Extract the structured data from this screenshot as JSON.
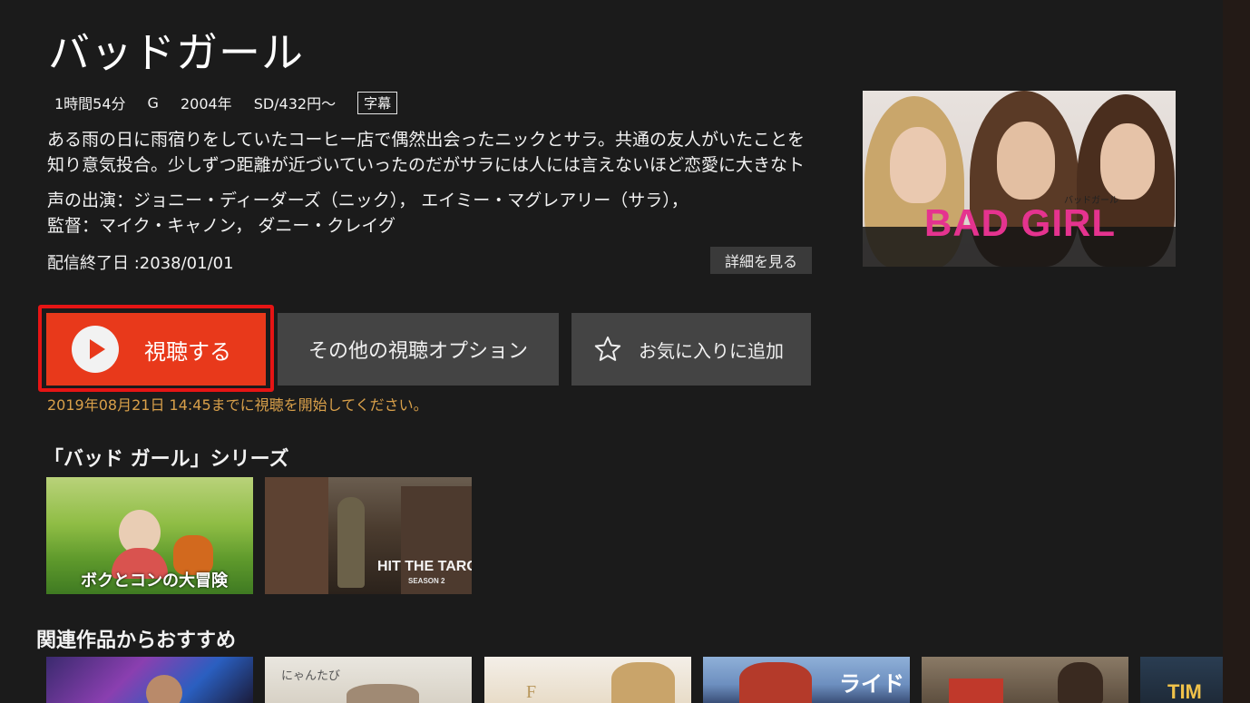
{
  "title": "バッドガール",
  "meta": {
    "duration": "1時間54分",
    "rating": "G",
    "year": "2004年",
    "price": "SD/432円〜",
    "subtitle_badge": "字幕"
  },
  "description": "ある雨の日に雨宿りをしていたコーヒー店で偶然出会ったニックとサラ。共通の友人がいたことを知り意気投合。少しずつ距離が近づいていったのだがサラには人には言えないほど恋愛に大きなト",
  "voice_cast": "声の出演：ジョニー・ディーダーズ（ニック）， エイミー・マグレアリー（サラ），",
  "director": "監督：マイク・キャノン， ダニー・クレイグ",
  "end_date": "配信終了日 :2038/01/01",
  "details_button": "詳細を見る",
  "poster": {
    "brand": "BAD GIRL",
    "kana": "バッドガール"
  },
  "buttons": {
    "play": "視聴する",
    "options": "その他の視聴オプション",
    "favorite": "お気に入りに追加"
  },
  "deadline": "2019年08月21日 14:45までに視聴を開始してください。",
  "series_section": {
    "title": "「バッド ガール」シリーズ",
    "items": [
      {
        "label": "ボクとコンの大冒険"
      },
      {
        "label": "HIT THE TARGET",
        "sub": "SEASON 2"
      }
    ]
  },
  "related_section": {
    "title": "関連作品からおすすめ",
    "items": [
      {
        "label": ""
      },
      {
        "label": "にゃんたび"
      },
      {
        "label": "F"
      },
      {
        "label": "ライド"
      },
      {
        "label": ""
      },
      {
        "label": "TIM"
      }
    ]
  },
  "colors": {
    "background": "#1b1b1b",
    "play_button": "#e8391b",
    "focus_ring": "#e61414",
    "secondary_button": "#444444",
    "deadline_text": "#d9a04a",
    "poster_brand": "#e5338f"
  }
}
